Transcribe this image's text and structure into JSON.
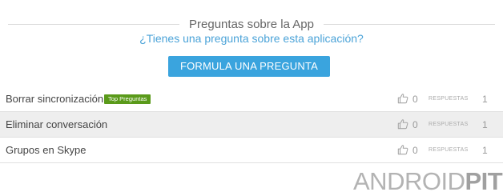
{
  "section": {
    "title": "Preguntas sobre la App",
    "ask_link": "¿Tienes una pregunta sobre esta aplicación?",
    "ask_button": "FORMULA UNA PREGUNTA"
  },
  "questions": [
    {
      "title": "Borrar sincronización",
      "badge": "Top Preguntas",
      "likes": "0",
      "answers_label": "RESPUESTAS",
      "answers": "1"
    },
    {
      "title": "Eliminar conversación",
      "likes": "0",
      "answers_label": "RESPUESTAS",
      "answers": "1"
    },
    {
      "title": "Grupos en Skype",
      "likes": "0",
      "answers_label": "RESPUESTAS",
      "answers": "1"
    }
  ],
  "watermark": {
    "part1": "ANDROID",
    "part2": "PIT"
  },
  "colors": {
    "accent": "#3aa4de",
    "link": "#4ba3d8",
    "badge": "#5a9a1a",
    "row_highlight": "#eeeeee"
  },
  "icons": {
    "like": "thumbs-up-icon"
  }
}
